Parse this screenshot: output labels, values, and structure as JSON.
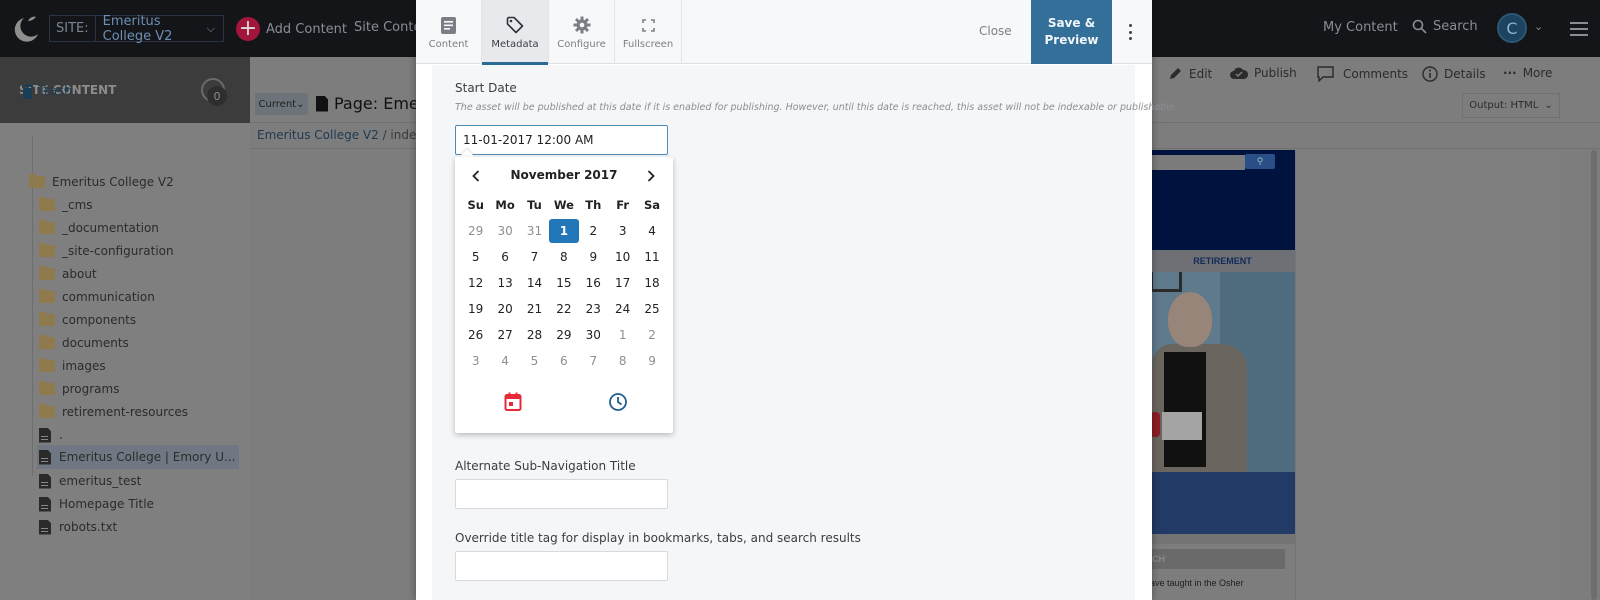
{
  "topbar": {
    "site_label": "SITE:",
    "site_value": "Emeritus College V2",
    "add_content": "Add Content",
    "site_content": "Site Content",
    "my_content": "My Content",
    "search": "Search",
    "avatar_initial": "C"
  },
  "sidebar": {
    "title": "SITE CONTENT",
    "trash_label": "Trash",
    "trash_count": "0",
    "root": "Emeritus College V2",
    "folders": [
      "_cms",
      "_documentation",
      "_site-configuration",
      "about",
      "communication",
      "components",
      "documents",
      "images",
      "programs",
      "retirement-resources"
    ],
    "files": [
      {
        "label": ".",
        "type": "page",
        "selected": false
      },
      {
        "label": "Emeritus College | Emory U...",
        "type": "page",
        "selected": true
      },
      {
        "label": "emeritus_test",
        "type": "page",
        "selected": false
      },
      {
        "label": "Homepage Title",
        "type": "page",
        "selected": false
      },
      {
        "label": "robots.txt",
        "type": "file",
        "selected": false
      }
    ]
  },
  "page": {
    "version_select": "Current",
    "title": "Page: Eme",
    "breadcrumb": [
      "Emeritus College V2",
      "index"
    ],
    "actions": [
      "Edit",
      "Publish",
      "Comments",
      "Details",
      "More"
    ],
    "output_select": "Output: HTML"
  },
  "preview": {
    "nav_label": "RETIREMENT",
    "section_label": "CH",
    "body_text": "ave taught in the Osher"
  },
  "modal": {
    "tabs": [
      {
        "label": "Content",
        "icon": "document-icon",
        "active": false
      },
      {
        "label": "Metadata",
        "icon": "tag-icon",
        "active": true
      },
      {
        "label": "Configure",
        "icon": "gear-icon",
        "active": false
      },
      {
        "label": "Fullscreen",
        "icon": "fullscreen-icon",
        "active": false
      }
    ],
    "close_label": "Close",
    "save_label_line1": "Save &",
    "save_label_line2": "Preview",
    "colors": {
      "accent": "#336f99",
      "selected_day": "#2277b8",
      "calendar_icon": "#e8293a"
    },
    "form": {
      "start_date_label": "Start Date",
      "start_date_help": "The asset will be published at this date if it is enabled for publishing. However, until this date is reached, this asset will not be indexable or publishable.",
      "start_date_value": "11-01-2017 12:00 AM",
      "alt_subnav_label": "Alternate Sub-Navigation Title",
      "alt_subnav_value": "",
      "override_title_label": "Override title tag for display in bookmarks, tabs, and search results",
      "override_title_value": ""
    },
    "datepicker": {
      "month_title": "November 2017",
      "weekdays": [
        "Su",
        "Mo",
        "Tu",
        "We",
        "Th",
        "Fr",
        "Sa"
      ],
      "weeks": [
        [
          {
            "d": "29",
            "m": true
          },
          {
            "d": "30",
            "m": true
          },
          {
            "d": "31",
            "m": true
          },
          {
            "d": "1",
            "s": true
          },
          {
            "d": "2"
          },
          {
            "d": "3"
          },
          {
            "d": "4"
          }
        ],
        [
          {
            "d": "5"
          },
          {
            "d": "6"
          },
          {
            "d": "7"
          },
          {
            "d": "8"
          },
          {
            "d": "9"
          },
          {
            "d": "10"
          },
          {
            "d": "11"
          }
        ],
        [
          {
            "d": "12"
          },
          {
            "d": "13"
          },
          {
            "d": "14"
          },
          {
            "d": "15"
          },
          {
            "d": "16"
          },
          {
            "d": "17"
          },
          {
            "d": "18"
          }
        ],
        [
          {
            "d": "19"
          },
          {
            "d": "20"
          },
          {
            "d": "21"
          },
          {
            "d": "22"
          },
          {
            "d": "23"
          },
          {
            "d": "24"
          },
          {
            "d": "25"
          }
        ],
        [
          {
            "d": "26"
          },
          {
            "d": "27"
          },
          {
            "d": "28"
          },
          {
            "d": "29"
          },
          {
            "d": "30"
          },
          {
            "d": "1",
            "m": true
          },
          {
            "d": "2",
            "m": true
          }
        ],
        [
          {
            "d": "3",
            "m": true
          },
          {
            "d": "4",
            "m": true
          },
          {
            "d": "5",
            "m": true
          },
          {
            "d": "6",
            "m": true
          },
          {
            "d": "7",
            "m": true
          },
          {
            "d": "8",
            "m": true
          },
          {
            "d": "9",
            "m": true
          }
        ]
      ],
      "selected_date": "1"
    }
  }
}
